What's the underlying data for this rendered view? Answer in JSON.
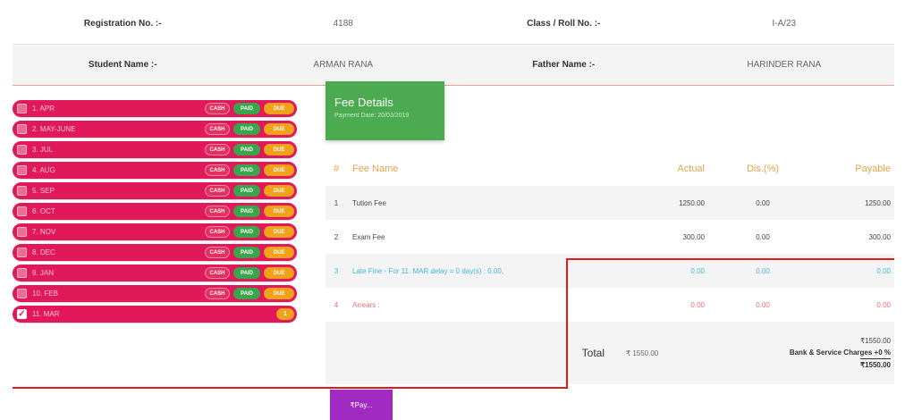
{
  "student": {
    "registration_label": "Registration No. :-",
    "registration_value": "4188",
    "class_label": "Class / Roll No. :-",
    "class_value": "I-A/23",
    "name_label": "Student Name :-",
    "name_value": "ARMAN RANA",
    "father_label": "Father Name :-",
    "father_value": "HARINDER RANA"
  },
  "months": [
    {
      "label": "1. APR",
      "cash": "CASH",
      "paid": "PAID",
      "due": "DUE"
    },
    {
      "label": "2. MAY-JUNE",
      "cash": "CASH",
      "paid": "PAID",
      "due": "DUE"
    },
    {
      "label": "3. JUL",
      "cash": "CASH",
      "paid": "PAID",
      "due": "DUE"
    },
    {
      "label": "4. AUG",
      "cash": "CASH",
      "paid": "PAID",
      "due": "DUE"
    },
    {
      "label": "5. SEP",
      "cash": "CASH",
      "paid": "PAID",
      "due": "DUE"
    },
    {
      "label": "6. OCT",
      "cash": "CASH",
      "paid": "PAID",
      "due": "DUE"
    },
    {
      "label": "7. NOV",
      "cash": "CASH",
      "paid": "PAID",
      "due": "DUE"
    },
    {
      "label": "8. DEC",
      "cash": "CASH",
      "paid": "PAID",
      "due": "DUE"
    },
    {
      "label": "9. JAN",
      "cash": "CASH",
      "paid": "PAID",
      "due": "DUE"
    },
    {
      "label": "10. FEB",
      "cash": "CASH",
      "paid": "PAID",
      "due": "DUE"
    },
    {
      "label": "11. MAR",
      "badge": "1"
    }
  ],
  "fee_details": {
    "title": "Fee Details",
    "payment_date": "Payment Date: 20/03/2019"
  },
  "fee_table": {
    "headers": {
      "no": "#",
      "name": "Fee Name",
      "actual": "Actual",
      "dis": "Dis.(%)",
      "payable": "Payable"
    },
    "rows": [
      {
        "no": "1",
        "name": "Tution Fee",
        "actual": "1250.00",
        "dis": "0.00",
        "payable": "1250.00"
      },
      {
        "no": "2",
        "name": "Exam Fee",
        "actual": "300.00",
        "dis": "0.00",
        "payable": "300.00"
      },
      {
        "no": "3",
        "name": "Late Fine - For 11. MAR delay = 0 day(s) : 0.00,",
        "actual": "0.00",
        "dis": "0.00",
        "payable": "0.00"
      },
      {
        "no": "4",
        "name": "Arrears :",
        "actual": "0.00",
        "dis": "0.00",
        "payable": "0.00"
      }
    ],
    "total_label": "Total",
    "total_actual": "₹ 1550.00",
    "total_payable": "₹1550.00",
    "charges_label": "Bank & Service Charges +0 %",
    "grand_total": "₹1550.00"
  },
  "pay_button": "₹Pay...",
  "colors": {
    "month_pill": "#e0195a",
    "paid": "#3aa64c",
    "due": "#f2a21a",
    "fee_header": "#4caa51",
    "pay_button": "#a12bc2",
    "highlight_box": "#e01b1b"
  }
}
